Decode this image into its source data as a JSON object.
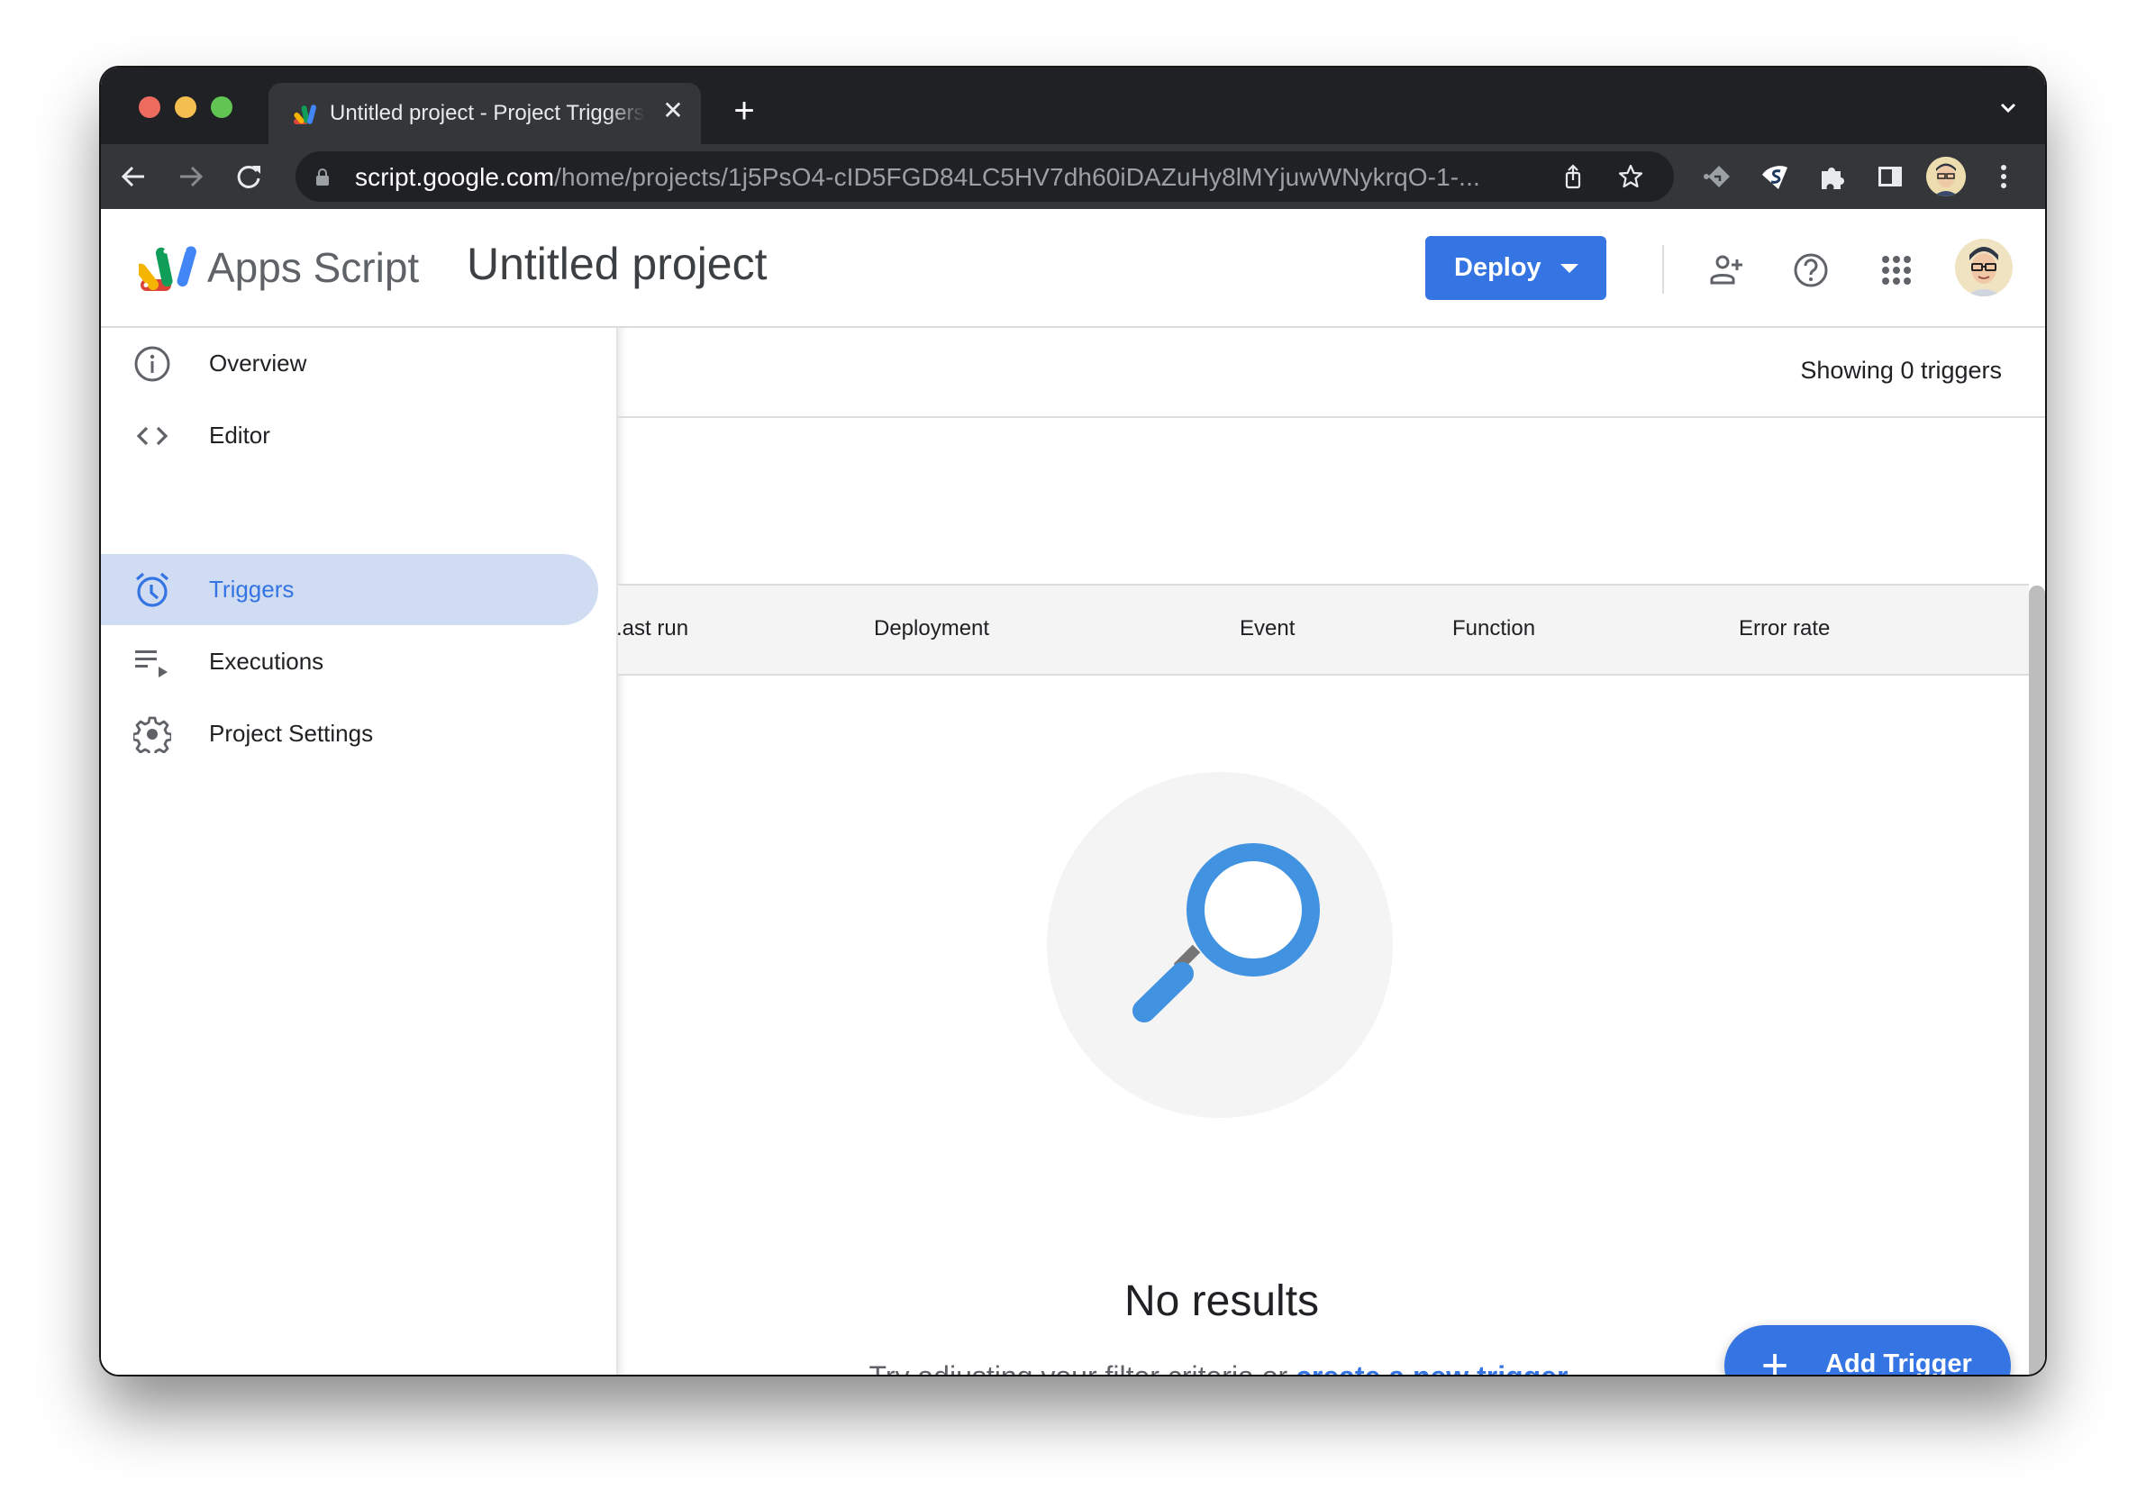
{
  "browser": {
    "window_controls": [
      "close",
      "minimize",
      "maximize"
    ],
    "traffic_light_colors": {
      "close": "#ed6a5e",
      "minimize": "#f5bf4f",
      "maximize": "#61c554"
    },
    "tab": {
      "title": "Untitled project - Project Triggers",
      "close_icon": "close-icon"
    },
    "new_tab_label": "+",
    "url_host": "script.google.com",
    "url_path": "/home/projects/1j5PsO4-cID5FGD84LC5HV7dh60iDAZuHy8lMYjuwWNykrqO-1-...",
    "toolbar_icons": [
      "share-icon",
      "bookmark-star-icon",
      "extension-1-icon",
      "extension-2-icon",
      "extensions-puzzle-icon",
      "side-panel-icon",
      "profile-avatar",
      "more-menu-icon"
    ]
  },
  "app": {
    "name": "Apps Script",
    "project_title": "Untitled project",
    "deploy_label": "Deploy",
    "header_icons": [
      "share-person-add-icon",
      "help-icon",
      "apps-grid-icon",
      "account-avatar"
    ],
    "accent_color": "#3574e3"
  },
  "sidebar": {
    "items": [
      {
        "label": "Overview",
        "icon": "info-icon",
        "active": false
      },
      {
        "label": "Editor",
        "icon": "code-icon",
        "active": false
      },
      {
        "label": "Triggers",
        "icon": "alarm-clock-icon",
        "active": true
      },
      {
        "label": "Executions",
        "icon": "executions-list-icon",
        "active": false
      },
      {
        "label": "Project Settings",
        "icon": "gear-icon",
        "active": false
      }
    ]
  },
  "main": {
    "count_text": "Showing 0 triggers",
    "columns": [
      "Last run",
      "Deployment",
      "Event",
      "Function",
      "Error rate"
    ],
    "columns_visible_text": [
      ".ast run",
      "Deployment",
      "Event",
      "Function",
      "Error rate"
    ],
    "rows": [],
    "empty_state": {
      "title": "No results",
      "subtitle_prefix": "Try adjusting your filter criteria or ",
      "link_text": "create a new trigger."
    },
    "fab_label": "Add Trigger"
  }
}
